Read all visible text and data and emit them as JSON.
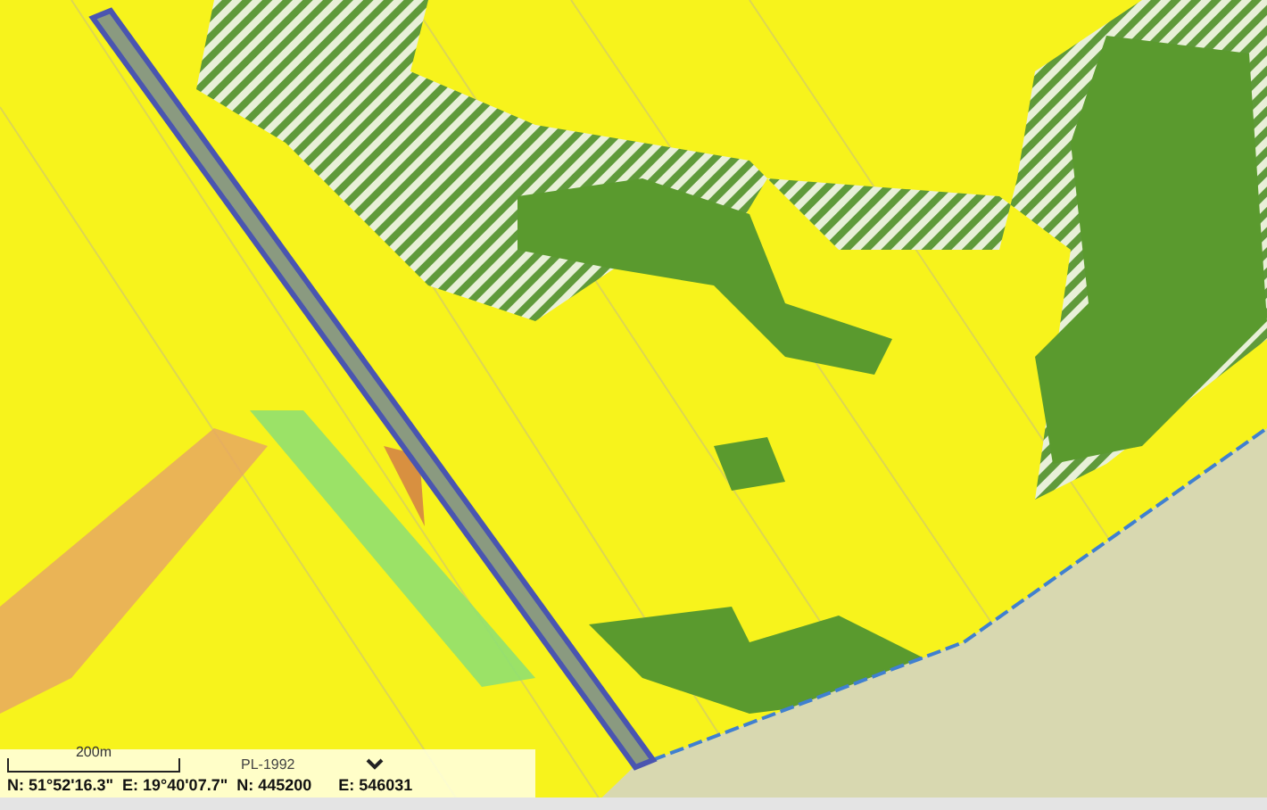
{
  "scale_bar": {
    "label": "200m"
  },
  "projection_select": {
    "value": "PL-1992"
  },
  "coordinates": [
    "N: 51°52'16.3\"",
    "E: 19°40'07.7\"",
    "N: 445200",
    "E: 546031"
  ]
}
